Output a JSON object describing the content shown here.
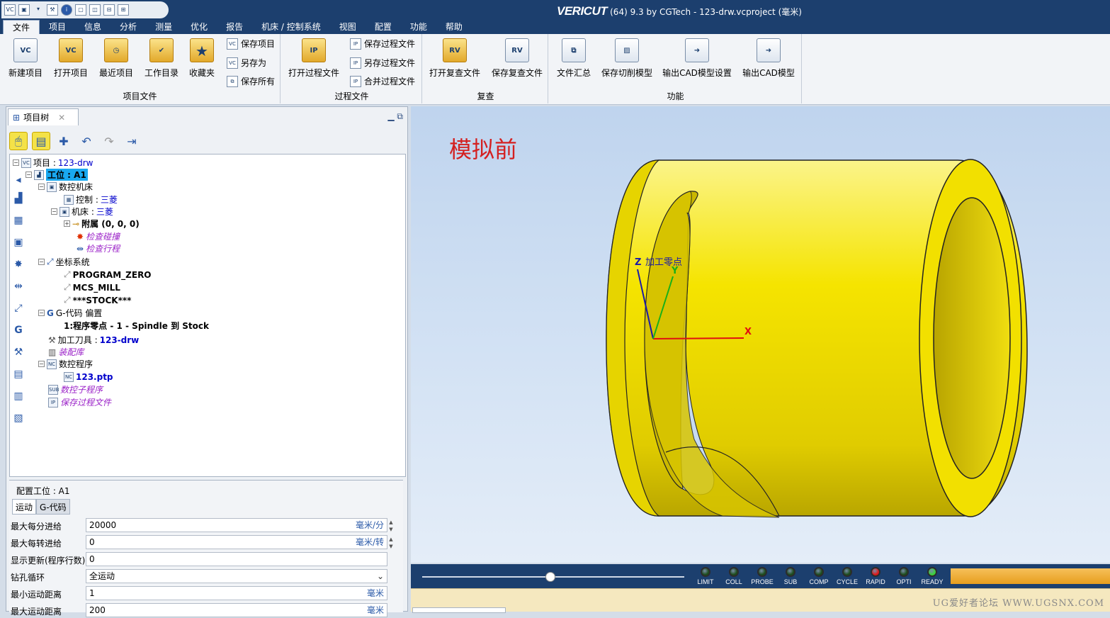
{
  "window": {
    "app_name": "VERICUT",
    "title_suffix": "(64)  9.3 by CGTech - 123-drw.vcproject (毫米)"
  },
  "menu": [
    "文件",
    "项目",
    "信息",
    "分析",
    "测量",
    "优化",
    "报告",
    "机床 / 控制系统",
    "视图",
    "配置",
    "功能",
    "帮助"
  ],
  "ribbon": {
    "project_file": {
      "label": "项目文件",
      "new": "新建项目",
      "open": "打开项目",
      "recent": "最近项目",
      "workdir": "工作目录",
      "favorites": "收藏夹",
      "save": "保存项目",
      "saveas": "另存为",
      "saveall": "保存所有"
    },
    "process_file": {
      "label": "过程文件",
      "open": "打开过程文件",
      "save": "保存过程文件",
      "saveas": "另存过程文件",
      "merge": "合并过程文件"
    },
    "review": {
      "label": "复查",
      "open": "打开复查文件",
      "save": "保存复查文件"
    },
    "function": {
      "label": "功能",
      "summary": "文件汇总",
      "save_cut": "保存切削模型",
      "export_cad_settings": "输出CAD模型设置",
      "export_cad": "输出CAD模型"
    }
  },
  "panel": {
    "tab_title": "项目树"
  },
  "tree": {
    "project_label": "项目 : ",
    "project_value": "123-drw",
    "station": "工位 : A1",
    "machine": "数控机床",
    "control_label": "控制 : ",
    "control_value": "三菱",
    "mach_label": "机床 : ",
    "mach_value": "三菱",
    "attach": "附属 (0, 0, 0)",
    "check_collision": "检查碰撞",
    "check_travel": "检查行程",
    "coords": "坐标系统",
    "cs1": "PROGRAM_ZERO",
    "cs2": "MCS_MILL",
    "cs3": "***STOCK***",
    "gcode_offset": "G-代码 偏置",
    "offset_item": "1:程序零点 - 1 - Spindle 到 Stock",
    "tools_label": "加工刀具 : ",
    "tools_value": "123-drw",
    "assembly": "装配库",
    "nc_program": "数控程序",
    "nc_file": "123.ptp",
    "nc_sub": "数控子程序",
    "save_ip": "保存过程文件"
  },
  "config": {
    "title": "配置工位 : A1",
    "tab_motion": "运动",
    "tab_gcode": "G-代码",
    "rows": [
      {
        "label": "最大每分进给",
        "value": "20000",
        "unit": "毫米/分"
      },
      {
        "label": "最大每转进给",
        "value": "0",
        "unit": "毫米/转"
      },
      {
        "label": "显示更新(程序行数)",
        "value": "0",
        "unit": ""
      },
      {
        "label": "钻孔循环",
        "value": "全运动",
        "unit": ""
      },
      {
        "label": "最小运动距离",
        "value": "1",
        "unit": "毫米"
      },
      {
        "label": "最大运动距离",
        "value": "200",
        "unit": "毫米"
      }
    ]
  },
  "viewport": {
    "label": "模拟前",
    "axis_z": "Z",
    "axis_y": "Y",
    "axis_x": "X",
    "origin": "加工零点",
    "part_color": "#f5e400"
  },
  "status_leds": [
    {
      "label": "LIMIT",
      "color": "#1d4d1d"
    },
    {
      "label": "COLL",
      "color": "#1d4d1d"
    },
    {
      "label": "PROBE",
      "color": "#1d4d1d"
    },
    {
      "label": "SUB",
      "color": "#1d4d1d"
    },
    {
      "label": "COMP",
      "color": "#1d4d1d"
    },
    {
      "label": "CYCLE",
      "color": "#1d4d1d"
    },
    {
      "label": "RAPID",
      "color": "#e01818"
    },
    {
      "label": "OPTI",
      "color": "#1d4d1d"
    },
    {
      "label": "READY",
      "color": "#3ad43a"
    }
  ],
  "watermark": "UG爱好者论坛 WWW.UGSNX.COM"
}
